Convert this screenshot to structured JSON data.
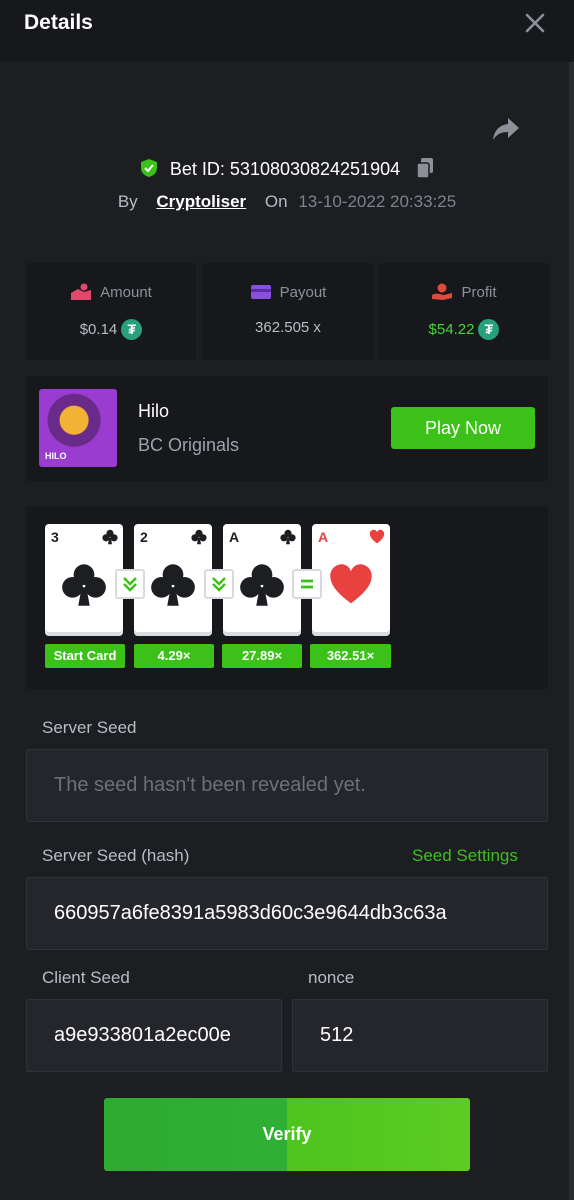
{
  "header": {
    "title": "Details",
    "close_icon": "close-icon"
  },
  "bet": {
    "id_label": "Bet ID:",
    "id": "53108030824251904",
    "by_label": "By",
    "user": "Cryptoliser",
    "on_label": "On",
    "datetime": "13-10-2022 20:33:25"
  },
  "stats": {
    "amount": {
      "label": "Amount",
      "value": "$0.14",
      "icon": "amount-icon"
    },
    "payout": {
      "label": "Payout",
      "value": "362.505 x",
      "icon": "wallet-icon"
    },
    "profit": {
      "label": "Profit",
      "value": "$54.22",
      "icon": "profit-icon"
    }
  },
  "currency_symbol": "₮",
  "game": {
    "name": "Hilo",
    "provider": "BC Originals",
    "play_label": "Play Now",
    "thumb_tag": "HILO"
  },
  "hand": {
    "cards": [
      {
        "rank": "3",
        "suit": "clubs",
        "multiplier": "Start Card"
      },
      {
        "rank": "2",
        "suit": "clubs",
        "multiplier": "4.29×"
      },
      {
        "rank": "A",
        "suit": "clubs",
        "multiplier": "27.89×"
      },
      {
        "rank": "A",
        "suit": "hearts",
        "multiplier": "362.51×"
      }
    ],
    "arrows": [
      "lower-icon",
      "lower-icon",
      "equal-icon"
    ]
  },
  "seed": {
    "server_label": "Server Seed",
    "server_placeholder": "The seed hasn't been revealed yet.",
    "hash_label": "Server Seed (hash)",
    "settings_link": "Seed Settings",
    "hash_value": "660957a6fe8391a5983d60c3e9644db3c63a",
    "client_label": "Client Seed",
    "client_value": "a9e933801a2ec00e",
    "nonce_label": "nonce",
    "nonce_value": "512",
    "verify_label": "Verify"
  },
  "colors": {
    "accent_green": "#3bc117",
    "background": "#1c1e22",
    "panel": "#17181b",
    "tether": "#26a17b"
  }
}
